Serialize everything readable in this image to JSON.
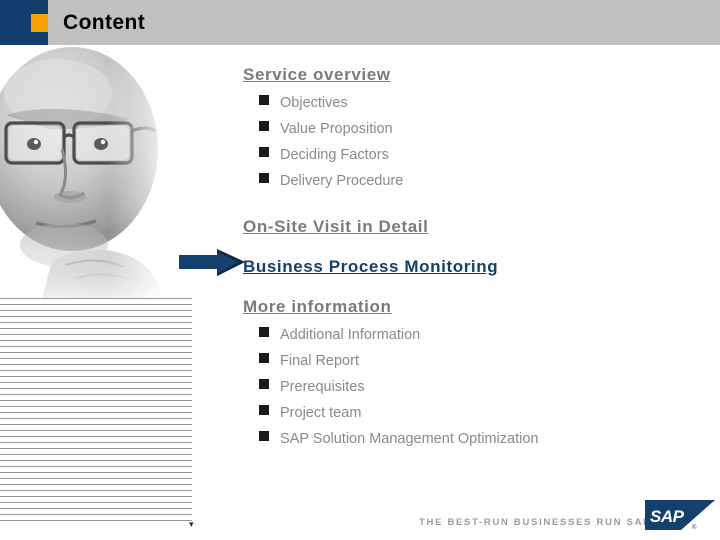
{
  "header": {
    "title": "Content",
    "accent_square_color": "#f5a300",
    "block_color": "#123d6e",
    "band_color": "#c0c0c0"
  },
  "outline": {
    "sections": [
      {
        "heading": "Service overview",
        "active": false,
        "items": [
          "Objectives",
          "Value Proposition",
          "Deciding Factors",
          "Delivery Procedure"
        ]
      },
      {
        "heading": "On-Site Visit in Detail",
        "active": false,
        "items": []
      },
      {
        "heading": "Business Process Monitoring",
        "active": true,
        "items": []
      },
      {
        "heading": "More information",
        "active": false,
        "items": [
          "Additional Information",
          "Final Report",
          "Prerequisites",
          "Project team",
          "SAP Solution Management Optimization"
        ]
      }
    ],
    "heading_color": "#7b7b7b",
    "active_color": "#15406e",
    "item_color": "#8a8a8a"
  },
  "pointer": {
    "icon": "right-arrow-icon",
    "color": "#15406e",
    "target_section": "Business Process Monitoring"
  },
  "photo": {
    "icon": "portrait-photo",
    "description": "grayscale portrait of man with glasses"
  },
  "footer": {
    "tagline": "THE BEST-RUN BUSINESSES RUN SAP",
    "logo_text": "SAP",
    "logo_trademark": "®",
    "logo_color": "#15406e",
    "tagline_color": "#9b9b9b"
  }
}
